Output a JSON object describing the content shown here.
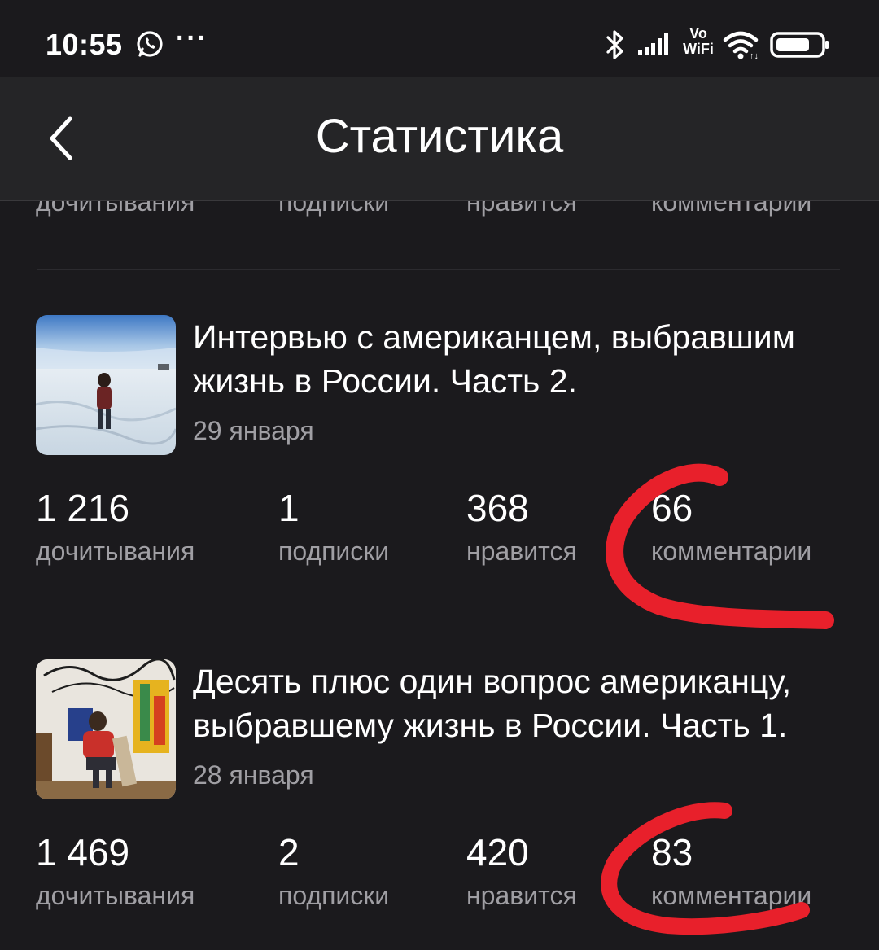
{
  "status_bar": {
    "time": "10:55",
    "dots": "···",
    "vowifi_top": "Vo",
    "vowifi_bottom": "WiFi",
    "icons": [
      "whatsapp-icon",
      "bluetooth-icon",
      "signal-icon",
      "wifi-icon",
      "battery-icon"
    ]
  },
  "header": {
    "title": "Статистика",
    "back_icon": "chevron-left-icon"
  },
  "partial_row": {
    "labels": [
      "дочитывания",
      "подписки",
      "нравится",
      "комментарии"
    ]
  },
  "articles": [
    {
      "title_line1": "Интервью с американцем, выбравшим",
      "title_line2": "жизнь в России. Часть 2.",
      "date": "29 января",
      "stats": {
        "reads": "1 216",
        "reads_label": "дочитывания",
        "subs": "1",
        "subs_label": "подписки",
        "likes": "368",
        "likes_label": "нравится",
        "comments": "66",
        "comments_label": "комментарии"
      }
    },
    {
      "title_line1": "Десять плюс один вопрос американцу,",
      "title_line2": "выбравшему жизнь в России. Часть 1.",
      "date": "28 января",
      "stats": {
        "reads": "1 469",
        "reads_label": "дочитывания",
        "subs": "2",
        "subs_label": "подписки",
        "likes": "420",
        "likes_label": "нравится",
        "comments": "83",
        "comments_label": "комментарии"
      }
    }
  ],
  "colors": {
    "background": "#1b1a1d",
    "header": "#252527",
    "secondary_text": "#a09fa4",
    "annotation": "#e8202b"
  }
}
